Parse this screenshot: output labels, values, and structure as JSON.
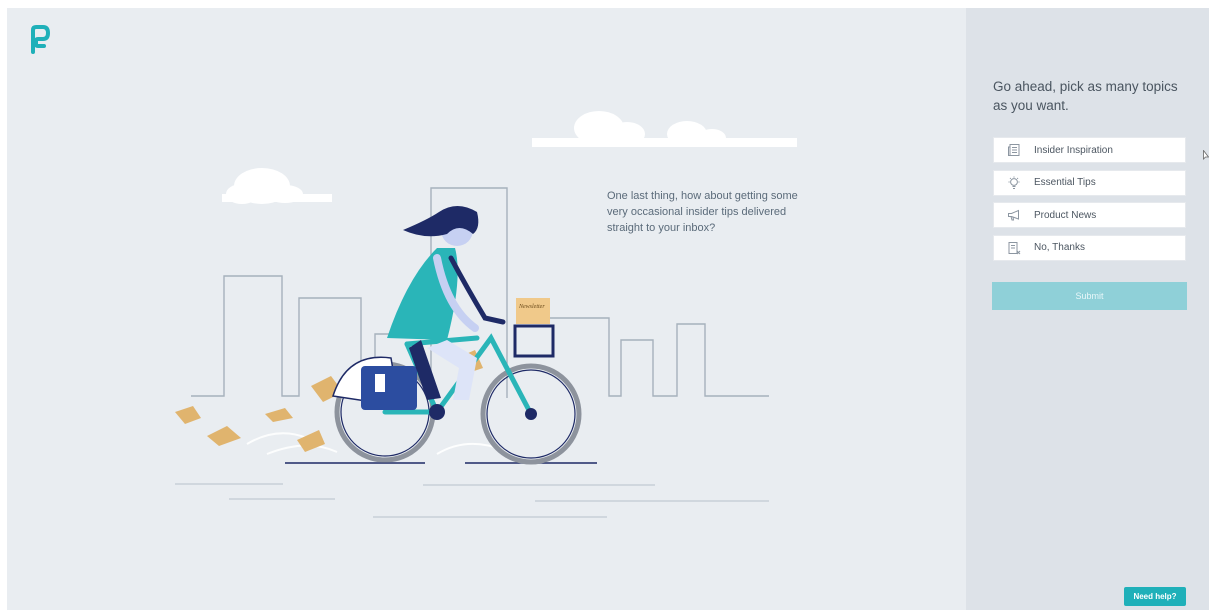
{
  "brand": {
    "logo_icon": "brand-logo-icon",
    "accent_color": "#1fb0b9"
  },
  "illustration": {
    "icon": "cyclist-delivering-newsletter-illustration",
    "basket_label": "Newsletter",
    "prompt": "One last thing, how about getting some very occasional insider tips delivered straight to your inbox?"
  },
  "sidebar": {
    "title": "Go ahead, pick as many topics as you want.",
    "topics": [
      {
        "label": "Insider Inspiration",
        "icon": "newspaper-icon"
      },
      {
        "label": "Essential Tips",
        "icon": "lightbulb-icon"
      },
      {
        "label": "Product News",
        "icon": "megaphone-icon"
      },
      {
        "label": "No, Thanks",
        "icon": "document-x-icon"
      }
    ],
    "submit_label": "Submit"
  },
  "help_button": {
    "label": "Need help?"
  }
}
